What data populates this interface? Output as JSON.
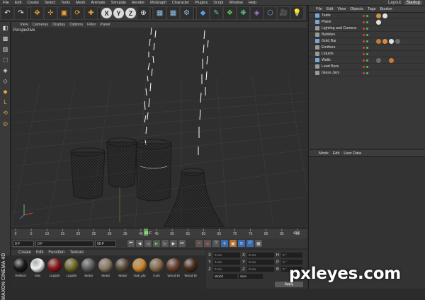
{
  "menubar": {
    "items": [
      "File",
      "Edit",
      "Create",
      "Select",
      "Tools",
      "Mesh",
      "Animate",
      "Simulate",
      "Render",
      "MoGraph",
      "Character",
      "Plugins",
      "Script",
      "Window",
      "Help"
    ],
    "layout_label": "Layout:",
    "layout_value": "Startup"
  },
  "toolbar": {
    "axis_x": "X",
    "axis_y": "Y",
    "axis_z": "Z"
  },
  "viewport_menu": [
    "View",
    "Cameras",
    "Display",
    "Options",
    "Filter",
    "Panel"
  ],
  "viewport": {
    "label": "Perspective"
  },
  "timeline": {
    "ticks": [
      "0",
      "5",
      "10",
      "15",
      "20",
      "25",
      "30",
      "35",
      "40",
      "45",
      "50",
      "55",
      "60",
      "65",
      "70",
      "75",
      "80",
      "85",
      "90"
    ],
    "current_frame": "43 F",
    "end_label": "42 F"
  },
  "transport": {
    "start_field": "0 F",
    "mid_field": "0 F",
    "end_field": "90 F"
  },
  "materials": {
    "menu": [
      "Create",
      "Edit",
      "Function",
      "Texture"
    ],
    "items": [
      {
        "label": "Reflecti",
        "color": "#1a1a1a"
      },
      {
        "label": "Mat",
        "color": "#f2f2f2"
      },
      {
        "label": "Liquids",
        "color": "#8c1616"
      },
      {
        "label": "Liquids",
        "color": "#6f6a24"
      },
      {
        "label": "Metal",
        "color": "#5e5e5e"
      },
      {
        "label": "Metal",
        "color": "#8a7a66"
      },
      {
        "label": "Metal",
        "color": "#5a4a36"
      },
      {
        "label": "Oak_pla",
        "color": "#d08a2c"
      },
      {
        "label": "Cork",
        "color": "#8a6a4a"
      },
      {
        "label": "Wood Bi",
        "color": "#6a4030"
      },
      {
        "label": "Wood Bi",
        "color": "#4a2c1a"
      }
    ]
  },
  "coords": {
    "rows": [
      {
        "a": "X",
        "av": "0 cm",
        "b": "X",
        "bv": "0 cm",
        "c": "H",
        "cv": "0 °"
      },
      {
        "a": "Y",
        "av": "0 cm",
        "b": "Y",
        "bv": "0 cm",
        "c": "P",
        "cv": "0 °"
      },
      {
        "a": "Z",
        "av": "0 cm",
        "b": "Z",
        "bv": "0 cm",
        "c": "B",
        "cv": "0 °"
      }
    ],
    "mode_left": "World",
    "mode_right": "Size",
    "apply": "Apply"
  },
  "object_manager": {
    "menu": [
      "File",
      "Edit",
      "View",
      "Objects",
      "Tags",
      "Bookm"
    ],
    "objects": [
      {
        "name": "Table",
        "color": "#7aa7d8"
      },
      {
        "name": "Plane",
        "color": "#7aa7d8"
      },
      {
        "name": "Lighting and Camera",
        "color": "#9a9a9a"
      },
      {
        "name": "Bubbles",
        "color": "#9a9a9a"
      },
      {
        "name": "Gold Bar",
        "color": "#7aa7d8"
      },
      {
        "name": "Emitters",
        "color": "#9a9a9a"
      },
      {
        "name": "Liquids",
        "color": "#9a9a9a"
      },
      {
        "name": "Walls",
        "color": "#7aa7d8"
      },
      {
        "name": "Lead Bars",
        "color": "#9a9a9a"
      },
      {
        "name": "Glass Jars",
        "color": "#9a9a9a"
      }
    ]
  },
  "attribute_manager": {
    "menu": [
      "Mode",
      "Edit",
      "User Data"
    ]
  },
  "watermark": "pxleyes.com",
  "app_vertical_label": "MAXON CINEMA 4D"
}
